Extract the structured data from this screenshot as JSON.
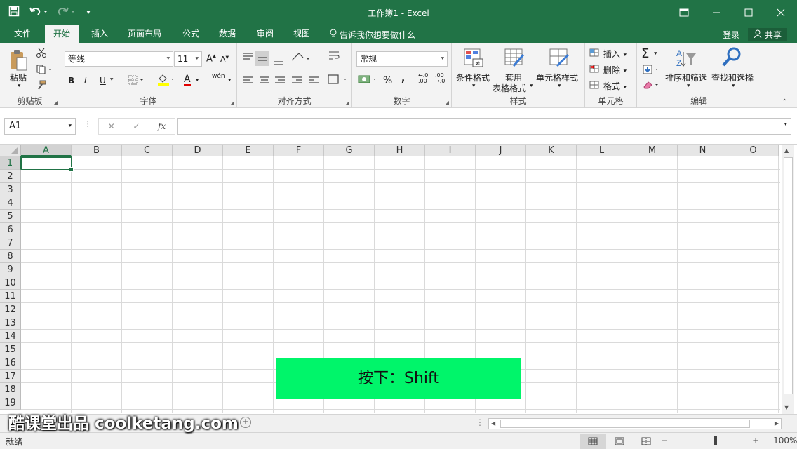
{
  "window": {
    "title": "工作簿1 - Excel",
    "accent": "#217346"
  },
  "qat": {
    "save_icon": "save-icon",
    "undo_icon": "undo-icon",
    "redo_icon": "redo-icon",
    "customize_icon": "chevron-down-icon"
  },
  "tabs": [
    {
      "label": "文件"
    },
    {
      "label": "开始"
    },
    {
      "label": "插入"
    },
    {
      "label": "页面布局"
    },
    {
      "label": "公式"
    },
    {
      "label": "数据"
    },
    {
      "label": "审阅"
    },
    {
      "label": "视图"
    }
  ],
  "tell_me": "告诉我你想要做什么",
  "account": {
    "signin": "登录",
    "share": "共享"
  },
  "ribbon": {
    "clipboard": {
      "name": "剪贴板",
      "paste": "粘贴"
    },
    "font": {
      "name": "字体",
      "font_name": "等线",
      "font_size": "11",
      "bold": "B",
      "italic": "I",
      "underline": "U",
      "grow": "A",
      "shrink": "A",
      "font_color": "A",
      "phonetic": "wén"
    },
    "alignment": {
      "name": "对齐方式"
    },
    "number": {
      "name": "数字",
      "format": "常规",
      "percent": "%",
      "comma": ","
    },
    "styles": {
      "name": "样式",
      "conditional": "条件格式",
      "table_line1": "套用",
      "table_line2": "表格格式",
      "cell_styles": "单元格样式"
    },
    "cells": {
      "name": "单元格",
      "insert": "插入",
      "delete": "删除",
      "format": "格式"
    },
    "editing": {
      "name": "编辑",
      "sum": "Σ",
      "sort": "排序和筛选",
      "find": "查找和选择"
    }
  },
  "formula_bar": {
    "name_box": "A1",
    "fx": "fx",
    "cancel": "✕",
    "enter": "✓",
    "value": ""
  },
  "columns": [
    "A",
    "B",
    "C",
    "D",
    "E",
    "F",
    "G",
    "H",
    "I",
    "J",
    "K",
    "L",
    "M",
    "N",
    "O"
  ],
  "rows": [
    "1",
    "2",
    "3",
    "4",
    "5",
    "6",
    "7",
    "8",
    "9",
    "10",
    "11",
    "12",
    "13",
    "14",
    "15",
    "16",
    "17",
    "18",
    "19"
  ],
  "selected_cell": "A1",
  "status": {
    "ready": "就绪",
    "zoom": "100%",
    "zoom_out": "−",
    "zoom_in": "+"
  },
  "overlay": {
    "keypress": "按下：Shift",
    "watermark": "酷课堂出品 coolketang.com",
    "keypress_color": "#00f56a"
  }
}
